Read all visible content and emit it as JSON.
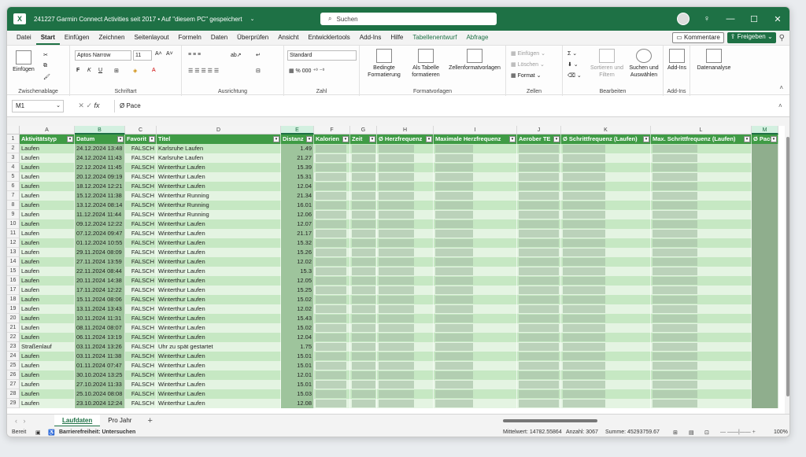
{
  "titlebar": {
    "app_icon": "excel-icon",
    "document_title": "241227 Garmin Connect Activities seit 2017 • Auf \"diesem PC\" gespeichert",
    "search_placeholder": "Suchen",
    "title_bg": "#1e7145"
  },
  "menu": {
    "items": [
      "Datei",
      "Start",
      "Einfügen",
      "Zeichnen",
      "Seitenlayout",
      "Formeln",
      "Daten",
      "Überprüfen",
      "Ansicht",
      "Entwicklertools",
      "Add-Ins",
      "Hilfe",
      "Tabellenentwurf",
      "Abfrage"
    ],
    "active": "Start",
    "kommentare": "Kommentare",
    "freigeben": "Freigeben"
  },
  "ribbon": {
    "clipboard": {
      "paste": "Einfügen",
      "group": "Zwischenablage"
    },
    "font": {
      "name": "Aptos Narrow",
      "size": "11",
      "group": "Schriftart"
    },
    "alignment": {
      "group": "Ausrichtung"
    },
    "number": {
      "format": "Standard",
      "group": "Zahl"
    },
    "styles": {
      "conditional": "Bedingte Formatierung",
      "as_table": "Als Tabelle formatieren",
      "cell_styles": "Zellenformatvorlagen",
      "group": "Formatvorlagen"
    },
    "cells": {
      "insert": "Einfügen",
      "delete": "Löschen",
      "format": "Format",
      "group": "Zellen"
    },
    "editing": {
      "sort": "Sortieren und Filtern",
      "find": "Suchen und Auswählen",
      "group": "Bearbeiten"
    },
    "addins": {
      "label": "Add-Ins",
      "group": "Add-Ins"
    },
    "analysis": {
      "label": "Datenanalyse"
    }
  },
  "formula_bar": {
    "name_box": "M1",
    "content": "Ø Pace"
  },
  "columns": [
    "A",
    "B",
    "C",
    "D",
    "E",
    "F",
    "G",
    "H",
    "I",
    "J",
    "K",
    "L",
    "M"
  ],
  "selected_column": "M",
  "table_headers": [
    "Aktivitätstyp",
    "Datum",
    "Favorit",
    "Titel",
    "Distanz",
    "Kalorien",
    "Zeit",
    "Ø Herzfrequenz",
    "Maximale Herzfrequenz",
    "Aerober TE",
    "Ø Schrittfrequenz (Laufen)",
    "Max. Schrittfrequenz (Laufen)",
    "Ø Pace"
  ],
  "rows": [
    {
      "n": "2",
      "typ": "Laufen",
      "datum": "24.12.2024 13:48",
      "fav": "FALSCH",
      "titel": "Karlsruhe Laufen",
      "dist": "1.49"
    },
    {
      "n": "3",
      "typ": "Laufen",
      "datum": "24.12.2024 11:43",
      "fav": "FALSCH",
      "titel": "Karlsruhe Laufen",
      "dist": "21.27"
    },
    {
      "n": "4",
      "typ": "Laufen",
      "datum": "22.12.2024 11:45",
      "fav": "FALSCH",
      "titel": "Winterthur Laufen",
      "dist": "15.39"
    },
    {
      "n": "5",
      "typ": "Laufen",
      "datum": "20.12.2024 09:19",
      "fav": "FALSCH",
      "titel": "Winterthur Laufen",
      "dist": "15.31"
    },
    {
      "n": "6",
      "typ": "Laufen",
      "datum": "18.12.2024 12:21",
      "fav": "FALSCH",
      "titel": "Winterthur Laufen",
      "dist": "12.04"
    },
    {
      "n": "7",
      "typ": "Laufen",
      "datum": "15.12.2024 11:38",
      "fav": "FALSCH",
      "titel": "Winterthur Running",
      "dist": "21.34"
    },
    {
      "n": "8",
      "typ": "Laufen",
      "datum": "13.12.2024 08:14",
      "fav": "FALSCH",
      "titel": "Winterthur Running",
      "dist": "16.01"
    },
    {
      "n": "9",
      "typ": "Laufen",
      "datum": "11.12.2024 11:44",
      "fav": "FALSCH",
      "titel": "Winterthur Running",
      "dist": "12.06"
    },
    {
      "n": "10",
      "typ": "Laufen",
      "datum": "09.12.2024 12:22",
      "fav": "FALSCH",
      "titel": "Winterthur Laufen",
      "dist": "12.07"
    },
    {
      "n": "11",
      "typ": "Laufen",
      "datum": "07.12.2024 09:47",
      "fav": "FALSCH",
      "titel": "Winterthur Laufen",
      "dist": "21.17"
    },
    {
      "n": "12",
      "typ": "Laufen",
      "datum": "01.12.2024 10:55",
      "fav": "FALSCH",
      "titel": "Winterthur Laufen",
      "dist": "15.32"
    },
    {
      "n": "13",
      "typ": "Laufen",
      "datum": "29.11.2024 08:09",
      "fav": "FALSCH",
      "titel": "Winterthur Laufen",
      "dist": "15.26"
    },
    {
      "n": "14",
      "typ": "Laufen",
      "datum": "27.11.2024 13:59",
      "fav": "FALSCH",
      "titel": "Winterthur Laufen",
      "dist": "12.02"
    },
    {
      "n": "15",
      "typ": "Laufen",
      "datum": "22.11.2024 08:44",
      "fav": "FALSCH",
      "titel": "Winterthur Laufen",
      "dist": "15.3"
    },
    {
      "n": "16",
      "typ": "Laufen",
      "datum": "20.11.2024 14:38",
      "fav": "FALSCH",
      "titel": "Winterthur Laufen",
      "dist": "12.05"
    },
    {
      "n": "17",
      "typ": "Laufen",
      "datum": "17.11.2024 12:22",
      "fav": "FALSCH",
      "titel": "Winterthur Laufen",
      "dist": "15.25"
    },
    {
      "n": "18",
      "typ": "Laufen",
      "datum": "15.11.2024 08:06",
      "fav": "FALSCH",
      "titel": "Winterthur Laufen",
      "dist": "15.02"
    },
    {
      "n": "19",
      "typ": "Laufen",
      "datum": "13.11.2024 13:43",
      "fav": "FALSCH",
      "titel": "Winterthur Laufen",
      "dist": "12.02"
    },
    {
      "n": "20",
      "typ": "Laufen",
      "datum": "10.11.2024 11:31",
      "fav": "FALSCH",
      "titel": "Winterthur Laufen",
      "dist": "15.43"
    },
    {
      "n": "21",
      "typ": "Laufen",
      "datum": "08.11.2024 08:07",
      "fav": "FALSCH",
      "titel": "Winterthur Laufen",
      "dist": "15.02"
    },
    {
      "n": "22",
      "typ": "Laufen",
      "datum": "06.11.2024 13:19",
      "fav": "FALSCH",
      "titel": "Winterthur Laufen",
      "dist": "12.04"
    },
    {
      "n": "23",
      "typ": "Straßenlauf",
      "datum": "03.11.2024 13:26",
      "fav": "FALSCH",
      "titel": "Uhr zu spät gestartet",
      "dist": "1.75"
    },
    {
      "n": "24",
      "typ": "Laufen",
      "datum": "03.11.2024 11:38",
      "fav": "FALSCH",
      "titel": "Winterthur Laufen",
      "dist": "15.01"
    },
    {
      "n": "25",
      "typ": "Laufen",
      "datum": "01.11.2024 07:47",
      "fav": "FALSCH",
      "titel": "Winterthur Laufen",
      "dist": "15.01"
    },
    {
      "n": "26",
      "typ": "Laufen",
      "datum": "30.10.2024 13:25",
      "fav": "FALSCH",
      "titel": "Winterthur Laufen",
      "dist": "12.01"
    },
    {
      "n": "27",
      "typ": "Laufen",
      "datum": "27.10.2024 11:33",
      "fav": "FALSCH",
      "titel": "Winterthur Laufen",
      "dist": "15.01"
    },
    {
      "n": "28",
      "typ": "Laufen",
      "datum": "25.10.2024 08:08",
      "fav": "FALSCH",
      "titel": "Winterthur Laufen",
      "dist": "15.03"
    },
    {
      "n": "29",
      "typ": "Laufen",
      "datum": "23.10.2024 12:24",
      "fav": "FALSCH",
      "titel": "Winterthur Laufen",
      "dist": "12.08"
    }
  ],
  "sheets": [
    "Laufdaten",
    "Pro Jahr"
  ],
  "active_sheet": "Laufdaten",
  "status": {
    "ready": "Bereit",
    "accessibility": "Barrierefreiheit: Untersuchen",
    "mittelwert": "Mittelwert: 14782.55864",
    "anzahl": "Anzahl: 3067",
    "summe": "Summe: 45293759.67",
    "zoom": "100%"
  },
  "colors": {
    "header_green": "#3f9b45",
    "row_light": "#e4f4e2",
    "row_dark": "#c6e8c3",
    "accent": "#1e7145"
  }
}
